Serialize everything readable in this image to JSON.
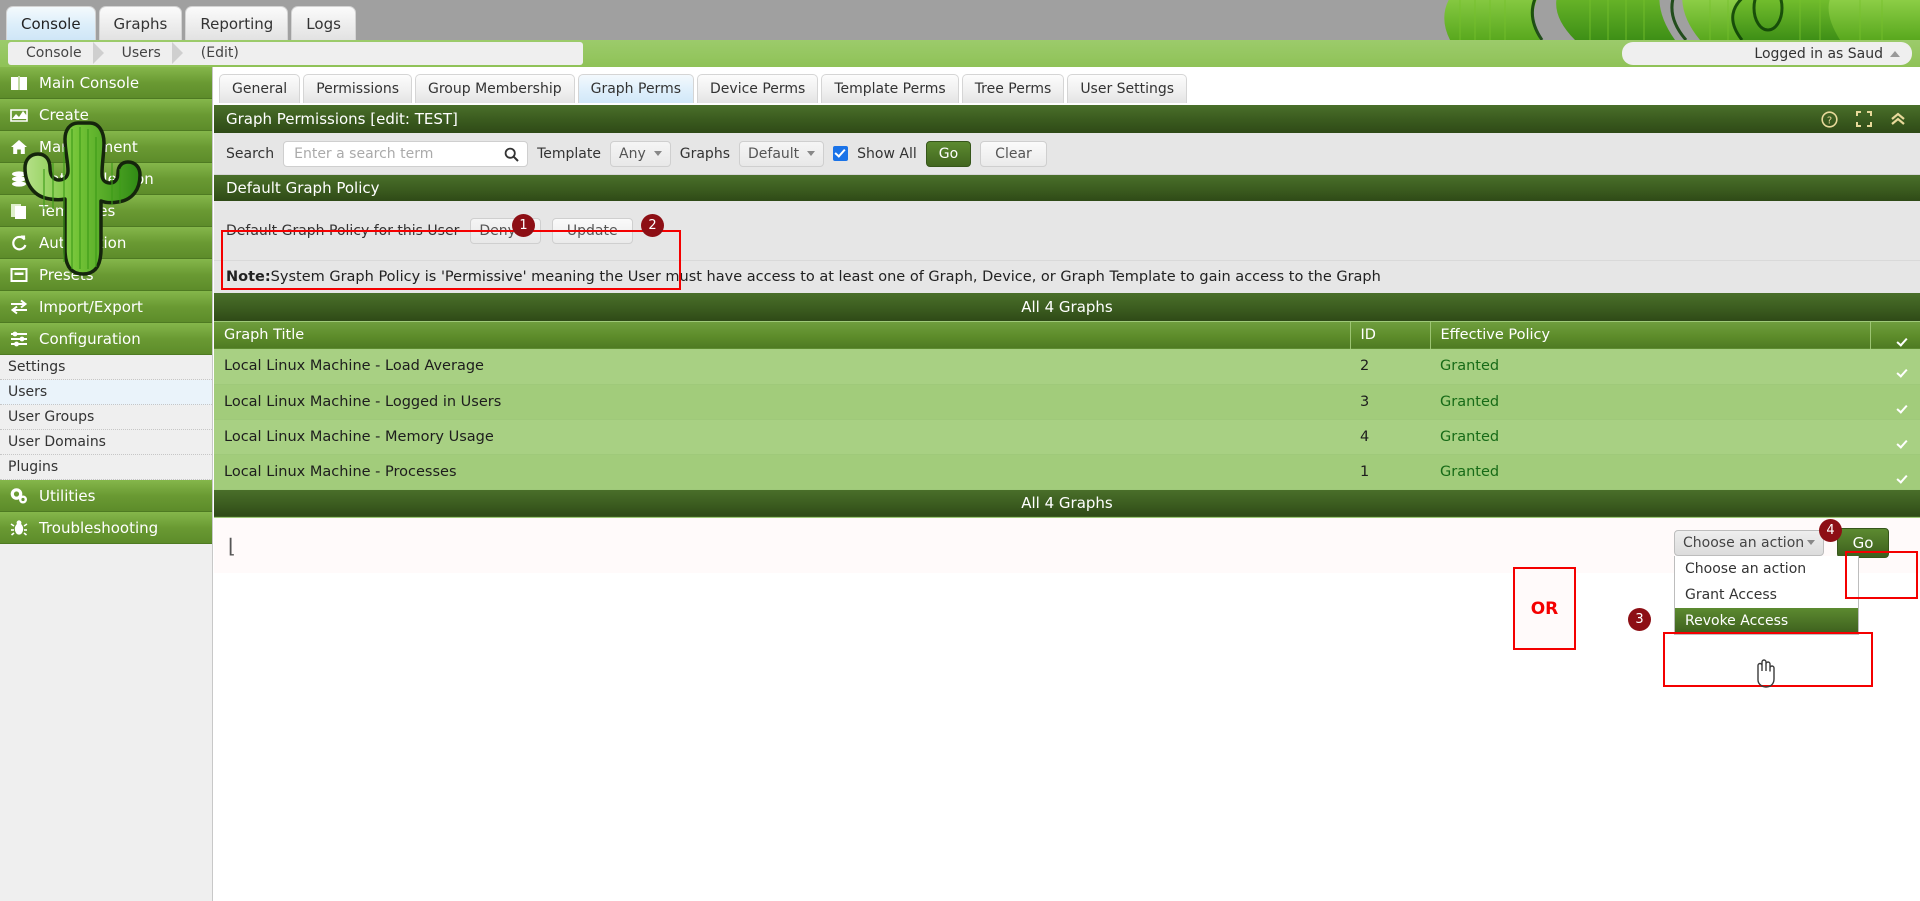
{
  "topbar": {
    "tabs": [
      {
        "label": "Console",
        "active": true
      },
      {
        "label": "Graphs",
        "active": false
      },
      {
        "label": "Reporting",
        "active": false
      },
      {
        "label": "Logs",
        "active": false
      }
    ]
  },
  "breadcrumb": {
    "items": [
      "Console",
      "Users",
      "(Edit)"
    ],
    "user_status": "Logged in as Saud"
  },
  "sidebar": {
    "main_items": [
      {
        "label": "Main Console",
        "icon": "book-icon"
      },
      {
        "label": "Create",
        "icon": "chart-icon"
      },
      {
        "label": "Management",
        "icon": "home-icon"
      },
      {
        "label": "Data Collection",
        "icon": "database-icon"
      },
      {
        "label": "Templates",
        "icon": "copy-icon"
      },
      {
        "label": "Automation",
        "icon": "refresh-icon"
      },
      {
        "label": "Presets",
        "icon": "archive-icon"
      },
      {
        "label": "Import/Export",
        "icon": "exchange-icon"
      },
      {
        "label": "Configuration",
        "icon": "sliders-icon"
      }
    ],
    "sub_items": [
      {
        "label": "Settings",
        "selected": false
      },
      {
        "label": "Users",
        "selected": true
      },
      {
        "label": "User Groups",
        "selected": false
      },
      {
        "label": "User Domains",
        "selected": false
      },
      {
        "label": "Plugins",
        "selected": false
      }
    ],
    "tail_items": [
      {
        "label": "Utilities",
        "icon": "gears-icon"
      },
      {
        "label": "Troubleshooting",
        "icon": "bug-icon"
      }
    ],
    "logo": "cactus-logo"
  },
  "subtabs": [
    {
      "label": "General",
      "active": false
    },
    {
      "label": "Permissions",
      "active": false
    },
    {
      "label": "Group Membership",
      "active": false
    },
    {
      "label": "Graph Perms",
      "active": true
    },
    {
      "label": "Device Perms",
      "active": false
    },
    {
      "label": "Template Perms",
      "active": false
    },
    {
      "label": "Tree Perms",
      "active": false
    },
    {
      "label": "User Settings",
      "active": false
    }
  ],
  "panel": {
    "title": "Graph Permissions [edit: TEST]",
    "icons": [
      "help-icon",
      "fullscreen-icon",
      "collapse-icon"
    ]
  },
  "filter": {
    "search_label": "Search",
    "search_value": "",
    "search_placeholder": "Enter a search term",
    "search_icon": "search-icon",
    "template_label": "Template",
    "template_value": "Any",
    "graphs_label": "Graphs",
    "graphs_value": "Default",
    "show_all_label": "Show All",
    "show_all_checked": true,
    "go_label": "Go",
    "clear_label": "Clear"
  },
  "policy": {
    "section_title": "Default Graph Policy",
    "row_label": "Default Graph Policy for this User",
    "select_value": "Deny",
    "update_label": "Update"
  },
  "note": {
    "prefix": "Note:",
    "text": " System Graph Policy is 'Permissive' meaning the User must have access to at least one of Graph, Device, or Graph Template to gain access to the Graph"
  },
  "table": {
    "caption_top": "All 4 Graphs",
    "caption_bottom": "All 4 Graphs",
    "columns": [
      "Graph Title",
      "ID",
      "Effective Policy"
    ],
    "select_all_checked": true,
    "rows": [
      {
        "title": "Local Linux Machine - Load Average",
        "id": "2",
        "policy": "Granted",
        "checked": true
      },
      {
        "title": "Local Linux Machine - Logged in Users",
        "id": "3",
        "policy": "Granted",
        "checked": true
      },
      {
        "title": "Local Linux Machine - Memory Usage",
        "id": "4",
        "policy": "Granted",
        "checked": true
      },
      {
        "title": "Local Linux Machine - Processes",
        "id": "1",
        "policy": "Granted",
        "checked": true
      }
    ]
  },
  "action": {
    "dropdown_value": "Choose an action",
    "options": [
      "Choose an action",
      "Grant Access",
      "Revoke Access"
    ],
    "highlighted_option": "Revoke Access",
    "go_label": "Go",
    "or_label": "OR"
  },
  "annotations": {
    "badges": [
      "1",
      "2",
      "3",
      "4"
    ],
    "accent_color": "#f40000",
    "badge_color": "#8d0f15"
  }
}
